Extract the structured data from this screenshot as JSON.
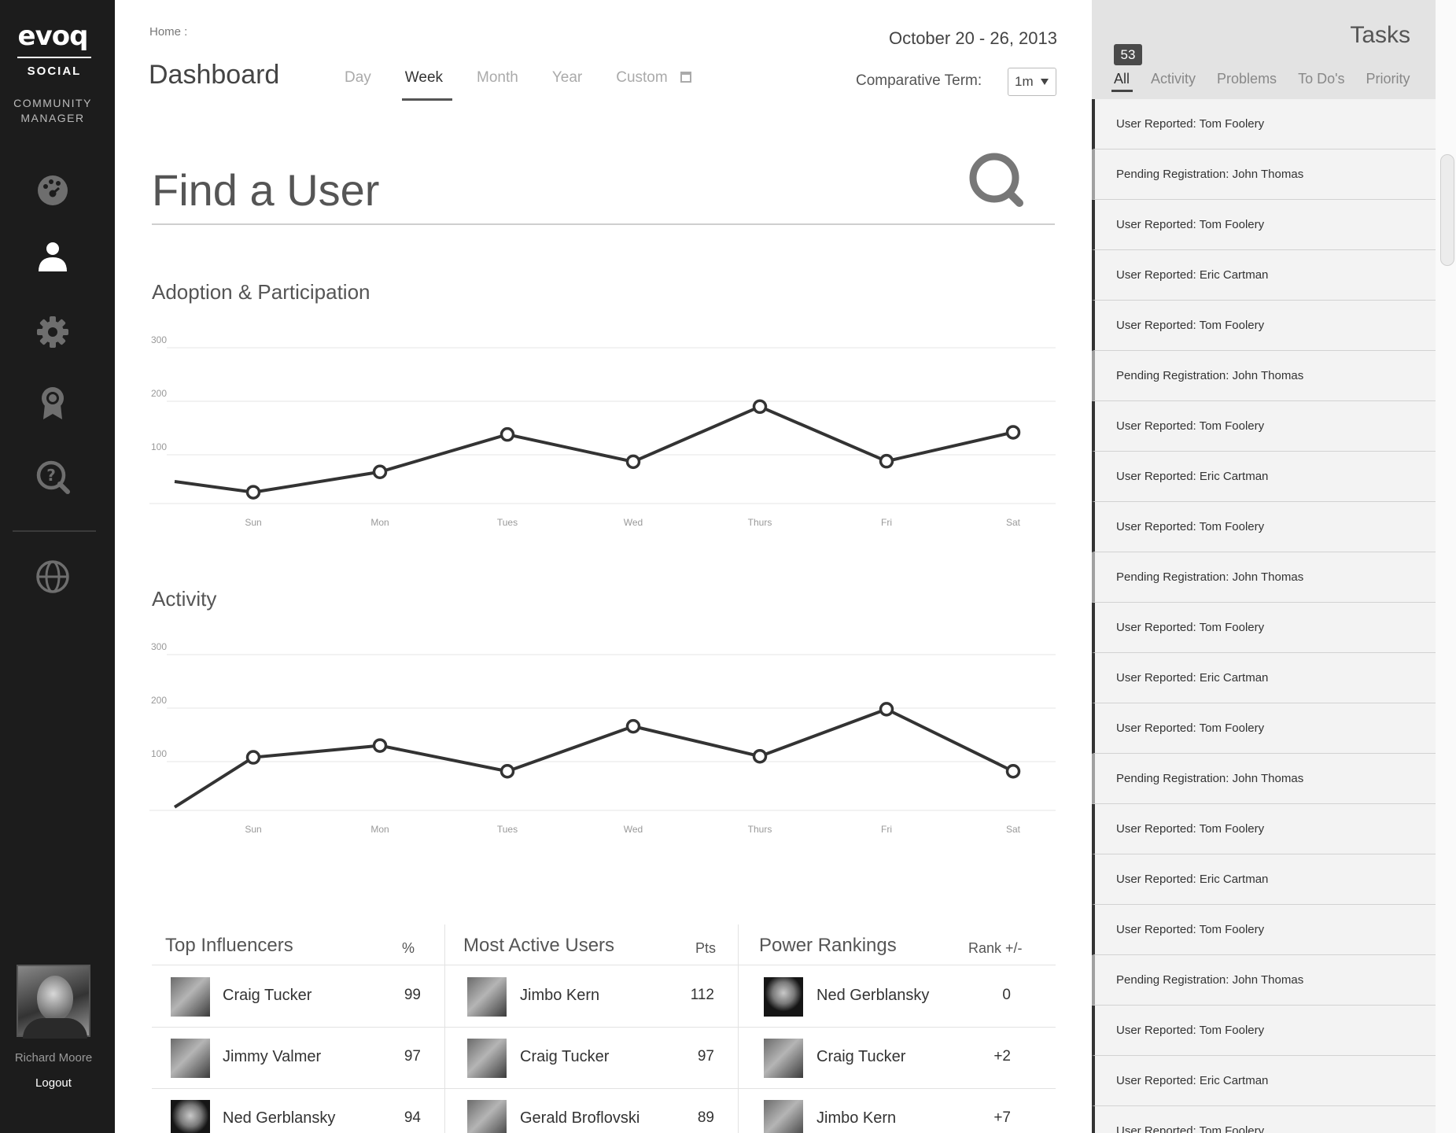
{
  "sidebar": {
    "logo": "evoq",
    "logo_sub": "SOCIAL",
    "role_line1": "COMMUNITY",
    "role_line2": "MANAGER",
    "nav": [
      "dashboard-icon",
      "user-icon",
      "gear-icon",
      "badge-icon",
      "help-search-icon",
      "globe-icon"
    ],
    "user_name": "Richard Moore",
    "logout": "Logout"
  },
  "header": {
    "breadcrumb": "Home :",
    "title": "Dashboard",
    "tabs": [
      {
        "label": "Day",
        "active": false
      },
      {
        "label": "Week",
        "active": true
      },
      {
        "label": "Month",
        "active": false
      },
      {
        "label": "Year",
        "active": false
      },
      {
        "label": "Custom",
        "active": false
      }
    ],
    "date_range": "October 20 - 26, 2013",
    "comparative_label": "Comparative Term:",
    "comparative_value": "1m"
  },
  "search": {
    "placeholder": "Find a User"
  },
  "chart_data": [
    {
      "type": "line",
      "title": "Adoption & Participation",
      "categories": [
        "Sun",
        "Mon",
        "Tues",
        "Wed",
        "Thurs",
        "Fri",
        "Sat"
      ],
      "yticks": [
        100,
        200,
        300
      ],
      "ylim": [
        0,
        300
      ],
      "start_value": 50,
      "values": [
        30,
        68,
        138,
        87,
        190,
        88,
        142
      ],
      "grid": true
    },
    {
      "type": "line",
      "title": "Activity",
      "categories": [
        "Sun",
        "Mon",
        "Tues",
        "Wed",
        "Thurs",
        "Fri",
        "Sat"
      ],
      "yticks": [
        100,
        200,
        300
      ],
      "ylim": [
        0,
        300
      ],
      "start_value": 15,
      "values": [
        108,
        130,
        82,
        166,
        110,
        198,
        82
      ],
      "grid": true
    }
  ],
  "leaderboards": [
    {
      "title": "Top Influencers",
      "col": "%",
      "rows": [
        {
          "name": "Craig Tucker",
          "value": "99",
          "thumb": "light"
        },
        {
          "name": "Jimmy Valmer",
          "value": "97",
          "thumb": "light"
        },
        {
          "name": "Ned Gerblansky",
          "value": "94",
          "thumb": "dark"
        }
      ]
    },
    {
      "title": "Most Active Users",
      "col": "Pts",
      "rows": [
        {
          "name": "Jimbo Kern",
          "value": "112",
          "thumb": "light"
        },
        {
          "name": "Craig Tucker",
          "value": "97",
          "thumb": "light"
        },
        {
          "name": "Gerald Broflovski",
          "value": "89",
          "thumb": "light"
        }
      ]
    },
    {
      "title": "Power Rankings",
      "col": "Rank +/-",
      "rows": [
        {
          "name": "Ned Gerblansky",
          "value": "0",
          "thumb": "dark"
        },
        {
          "name": "Craig Tucker",
          "value": "+2",
          "thumb": "light"
        },
        {
          "name": "Jimbo Kern",
          "value": "+7",
          "thumb": "light"
        }
      ]
    }
  ],
  "tasks": {
    "title": "Tasks",
    "count": "53",
    "tabs": [
      {
        "label": "All",
        "active": true
      },
      {
        "label": "Activity",
        "active": false
      },
      {
        "label": "Problems",
        "active": false
      },
      {
        "label": "To Do's",
        "active": false
      },
      {
        "label": "Priority",
        "active": false
      }
    ],
    "items": [
      {
        "label": "User Reported: Tom Foolery",
        "pending": false
      },
      {
        "label": "Pending Registration: John Thomas",
        "pending": true
      },
      {
        "label": "User Reported: Tom Foolery",
        "pending": false
      },
      {
        "label": "User Reported: Eric Cartman",
        "pending": false
      },
      {
        "label": "User Reported: Tom Foolery",
        "pending": false
      },
      {
        "label": "Pending Registration: John Thomas",
        "pending": true
      },
      {
        "label": "User Reported: Tom Foolery",
        "pending": false
      },
      {
        "label": "User Reported: Eric Cartman",
        "pending": false
      },
      {
        "label": "User Reported: Tom Foolery",
        "pending": false
      },
      {
        "label": "Pending Registration: John Thomas",
        "pending": true
      },
      {
        "label": "User Reported: Tom Foolery",
        "pending": false
      },
      {
        "label": "User Reported: Eric Cartman",
        "pending": false
      },
      {
        "label": "User Reported: Tom Foolery",
        "pending": false
      },
      {
        "label": "Pending Registration: John Thomas",
        "pending": true
      },
      {
        "label": "User Reported: Tom Foolery",
        "pending": false
      },
      {
        "label": "User Reported: Eric Cartman",
        "pending": false
      },
      {
        "label": "User Reported: Tom Foolery",
        "pending": false
      },
      {
        "label": "Pending Registration: John Thomas",
        "pending": true
      },
      {
        "label": "User Reported: Tom Foolery",
        "pending": false
      },
      {
        "label": "User Reported: Eric Cartman",
        "pending": false
      },
      {
        "label": "User Reported: Tom Foolery",
        "pending": false
      }
    ]
  },
  "colors": {
    "sidebar_bg": "#1c1c1c",
    "panel_bg": "#e3e3e3",
    "line": "#333333",
    "grid": "#e6e6e6"
  }
}
